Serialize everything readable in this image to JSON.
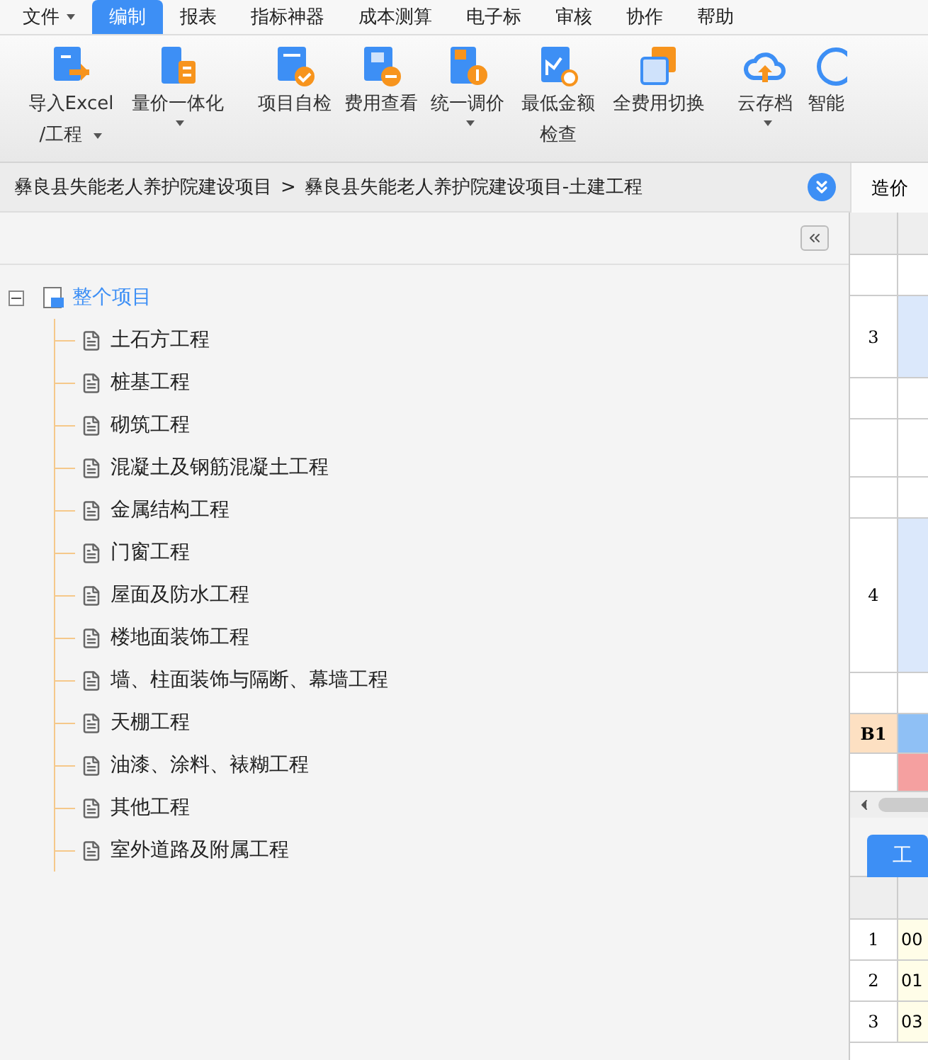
{
  "menu": [
    {
      "label": "文件",
      "dropdown": true,
      "selected": false
    },
    {
      "label": "编制",
      "dropdown": false,
      "selected": true
    },
    {
      "label": "报表",
      "dropdown": false,
      "selected": false
    },
    {
      "label": "指标神器",
      "dropdown": false,
      "selected": false
    },
    {
      "label": "成本测算",
      "dropdown": false,
      "selected": false
    },
    {
      "label": "电子标",
      "dropdown": false,
      "selected": false
    },
    {
      "label": "审核",
      "dropdown": false,
      "selected": false
    },
    {
      "label": "协作",
      "dropdown": false,
      "selected": false
    },
    {
      "label": "帮助",
      "dropdown": false,
      "selected": false
    }
  ],
  "toolbar": [
    {
      "kind": "import",
      "lines": [
        "导入Excel",
        "/工程"
      ],
      "dropdown": true
    },
    {
      "kind": "quantity",
      "lines": [
        "量价一体化"
      ],
      "dropdown": true
    },
    {
      "kind": "check",
      "lines": [
        "项目自检"
      ],
      "dropdown": false
    },
    {
      "kind": "fee",
      "lines": [
        "费用查看"
      ],
      "dropdown": false
    },
    {
      "kind": "price",
      "lines": [
        "统一调价"
      ],
      "dropdown": true
    },
    {
      "kind": "min",
      "lines": [
        "最低金额",
        "检查"
      ],
      "dropdown": false
    },
    {
      "kind": "switch",
      "lines": [
        "全费用切换"
      ],
      "dropdown": false
    },
    {
      "kind": "cloud",
      "lines": [
        "云存档"
      ],
      "dropdown": true
    },
    {
      "kind": "smart",
      "lines": [
        "智能"
      ],
      "dropdown": false
    }
  ],
  "breadcrumb": {
    "items": [
      "彝良县失能老人养护院建设项目",
      "彝良县失能老人养护院建设项目-土建工程"
    ],
    "separator": ">"
  },
  "right_tab": "造价",
  "tree": {
    "label": "整个项目",
    "expanded": true,
    "children": [
      {
        "label": "土石方工程"
      },
      {
        "label": "桩基工程"
      },
      {
        "label": "砌筑工程"
      },
      {
        "label": "混凝土及钢筋混凝土工程"
      },
      {
        "label": "金属结构工程"
      },
      {
        "label": "门窗工程"
      },
      {
        "label": "屋面及防水工程"
      },
      {
        "label": "楼地面装饰工程"
      },
      {
        "label": "墙、柱面装饰与隔断、幕墙工程"
      },
      {
        "label": "天棚工程"
      },
      {
        "label": "油漆、涂料、裱糊工程"
      },
      {
        "label": "其他工程"
      },
      {
        "label": "室外道路及附属工程"
      }
    ]
  },
  "upper_grid": {
    "rows": [
      {
        "label": "",
        "kind": "plain"
      },
      {
        "label": "3",
        "kind": "tall"
      },
      {
        "label": "",
        "kind": "plain"
      },
      {
        "label": "",
        "kind": "mid"
      },
      {
        "label": "",
        "kind": "plain"
      },
      {
        "label": "4",
        "kind": "xtall"
      },
      {
        "label": "",
        "kind": "plain"
      },
      {
        "label": "B1",
        "kind": "group"
      },
      {
        "label": "",
        "kind": "flag"
      }
    ]
  },
  "lower_tab": {
    "label": "工",
    "selected": true
  },
  "lower_grid": {
    "rows": [
      {
        "num": "1",
        "code": "00"
      },
      {
        "num": "2",
        "code": "01"
      },
      {
        "num": "3",
        "code": "03"
      }
    ]
  }
}
